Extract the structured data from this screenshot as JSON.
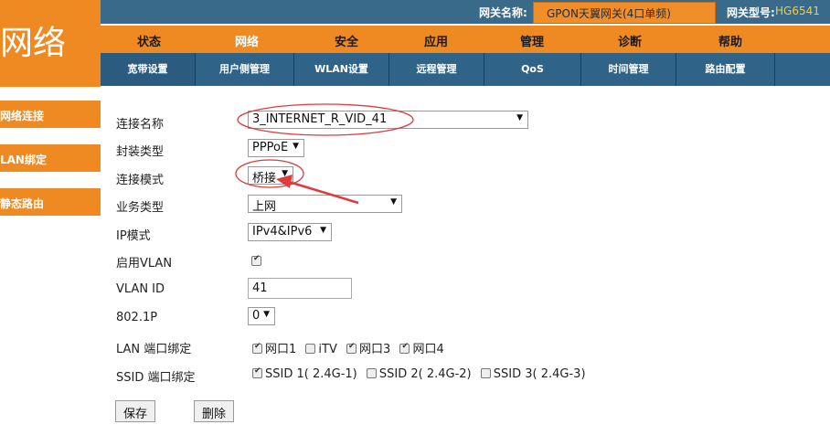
{
  "header": {
    "gateway_name_label": "网关名称:",
    "gateway_name_value": "GPON天翼网关(4口单频)",
    "gateway_model_label": "网关型号:",
    "gateway_model_value": "HG6541"
  },
  "logo": {
    "text": "网络"
  },
  "main_nav": [
    "状态",
    "网络",
    "安全",
    "应用",
    "管理",
    "诊断",
    "帮助"
  ],
  "sub_nav": [
    "宽带设置",
    "用户侧管理",
    "WLAN设置",
    "远程管理",
    "QoS",
    "时间管理",
    "路由配置"
  ],
  "sidebar": [
    "网络连接",
    "LAN绑定",
    "静态路由"
  ],
  "form": {
    "connection_name": {
      "label": "连接名称",
      "value": "3_INTERNET_R_VID_41"
    },
    "encap_type": {
      "label": "封装类型",
      "value": "PPPoE"
    },
    "connection_mode": {
      "label": "连接模式",
      "value": "桥接"
    },
    "service_type": {
      "label": "业务类型",
      "value": "上网"
    },
    "ip_mode": {
      "label": "IP模式",
      "value": "IPv4&IPv6"
    },
    "enable_vlan": {
      "label": "启用VLAN",
      "checked": true
    },
    "vlan_id": {
      "label": "VLAN ID",
      "value": "41"
    },
    "p8021": {
      "label": "802.1P",
      "value": "0"
    },
    "lan_binding": {
      "label": "LAN 端口绑定",
      "ports": [
        {
          "label": "网口1",
          "checked": true
        },
        {
          "label": "iTV",
          "checked": false
        },
        {
          "label": "网口3",
          "checked": true
        },
        {
          "label": "网口4",
          "checked": true
        }
      ]
    },
    "ssid_binding": {
      "label": "SSID 端口绑定",
      "ssids": [
        {
          "label": "SSID 1( 2.4G-1)",
          "checked": true
        },
        {
          "label": "SSID 2( 2.4G-2)",
          "checked": false
        },
        {
          "label": "SSID 3( 2.4G-3)",
          "checked": false
        }
      ]
    },
    "save_label": "保存",
    "delete_label": "删除"
  },
  "colors": {
    "orange": "#ef8a23",
    "nav_blue": "#2f6388",
    "annotation_red": "#e03a3a"
  }
}
